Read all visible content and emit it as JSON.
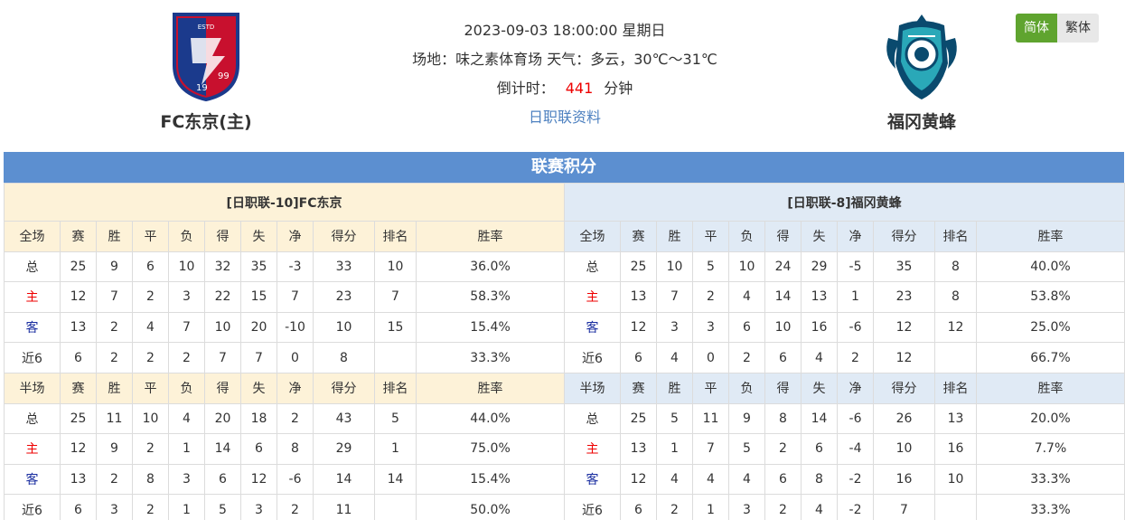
{
  "header": {
    "home_team": "FC东京(主)",
    "away_team": "福冈黄蜂",
    "datetime": "2023-09-03 18:00:00 星期日",
    "venue_weather": "场地：味之素体育场 天气：多云，30℃～31℃",
    "countdown_label": "倒计时：",
    "countdown_value": "441",
    "countdown_unit": "分钟",
    "league_link": "日职联资料",
    "lang_simplified": "简体",
    "lang_traditional": "繁体",
    "home_logo_text": [
      "ESTD",
      "19",
      "99"
    ]
  },
  "section_title": "联赛积分",
  "colors": {
    "bar": "#5c8fd0",
    "home_bg": "#fdf2d8",
    "away_bg": "#e0eaf5",
    "red": "#ee0000",
    "blue": "#1a2ea0",
    "lang_active": "#5fa42f"
  },
  "columns_full": [
    "全场",
    "赛",
    "胜",
    "平",
    "负",
    "得",
    "失",
    "净",
    "得分",
    "排名",
    "胜率"
  ],
  "columns_half": [
    "半场",
    "赛",
    "胜",
    "平",
    "负",
    "得",
    "失",
    "净",
    "得分",
    "排名",
    "胜率"
  ],
  "home": {
    "title": "[日职联-10]FC东京",
    "full": [
      [
        "总",
        "25",
        "9",
        "6",
        "10",
        "32",
        "35",
        "-3",
        "33",
        "10",
        "36.0%"
      ],
      [
        "主",
        "12",
        "7",
        "2",
        "3",
        "22",
        "15",
        "7",
        "23",
        "7",
        "58.3%"
      ],
      [
        "客",
        "13",
        "2",
        "4",
        "7",
        "10",
        "20",
        "-10",
        "10",
        "15",
        "15.4%"
      ],
      [
        "近6",
        "6",
        "2",
        "2",
        "2",
        "7",
        "7",
        "0",
        "8",
        "",
        "33.3%"
      ]
    ],
    "half": [
      [
        "总",
        "25",
        "11",
        "10",
        "4",
        "20",
        "18",
        "2",
        "43",
        "5",
        "44.0%"
      ],
      [
        "主",
        "12",
        "9",
        "2",
        "1",
        "14",
        "6",
        "8",
        "29",
        "1",
        "75.0%"
      ],
      [
        "客",
        "13",
        "2",
        "8",
        "3",
        "6",
        "12",
        "-6",
        "14",
        "14",
        "15.4%"
      ],
      [
        "近6",
        "6",
        "3",
        "2",
        "1",
        "5",
        "3",
        "2",
        "11",
        "",
        "50.0%"
      ]
    ]
  },
  "away": {
    "title": "[日职联-8]福冈黄蜂",
    "full": [
      [
        "总",
        "25",
        "10",
        "5",
        "10",
        "24",
        "29",
        "-5",
        "35",
        "8",
        "40.0%"
      ],
      [
        "主",
        "13",
        "7",
        "2",
        "4",
        "14",
        "13",
        "1",
        "23",
        "8",
        "53.8%"
      ],
      [
        "客",
        "12",
        "3",
        "3",
        "6",
        "10",
        "16",
        "-6",
        "12",
        "12",
        "25.0%"
      ],
      [
        "近6",
        "6",
        "4",
        "0",
        "2",
        "6",
        "4",
        "2",
        "12",
        "",
        "66.7%"
      ]
    ],
    "half": [
      [
        "总",
        "25",
        "5",
        "11",
        "9",
        "8",
        "14",
        "-6",
        "26",
        "13",
        "20.0%"
      ],
      [
        "主",
        "13",
        "1",
        "7",
        "5",
        "2",
        "6",
        "-4",
        "10",
        "16",
        "7.7%"
      ],
      [
        "客",
        "12",
        "4",
        "4",
        "4",
        "6",
        "8",
        "-2",
        "16",
        "10",
        "33.3%"
      ],
      [
        "近6",
        "6",
        "2",
        "1",
        "3",
        "2",
        "4",
        "-2",
        "7",
        "",
        "33.3%"
      ]
    ]
  }
}
